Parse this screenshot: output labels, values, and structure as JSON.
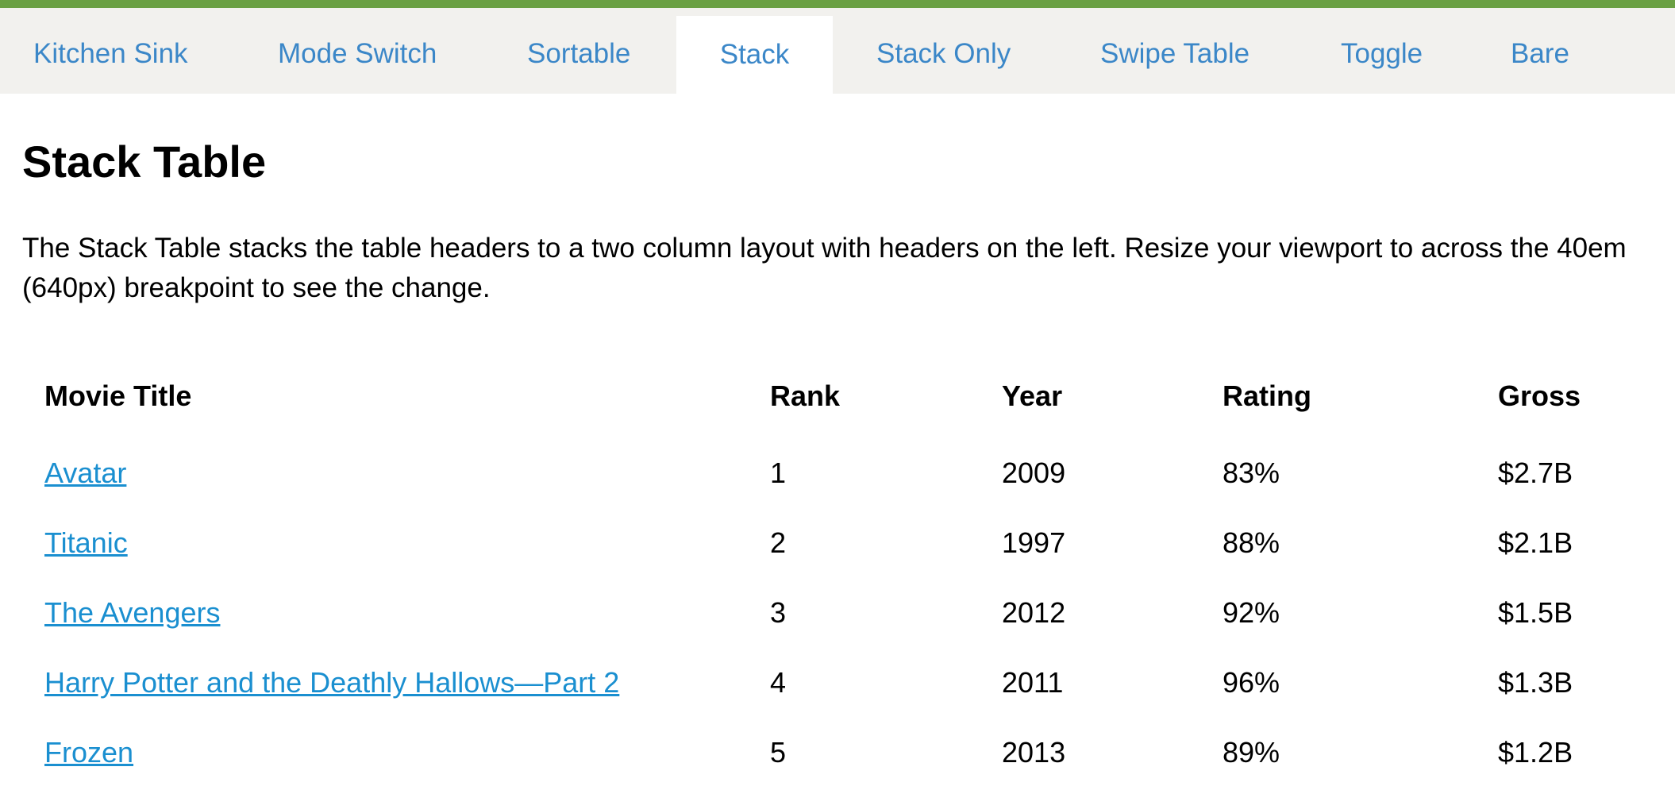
{
  "tabs": [
    {
      "label": "Kitchen Sink",
      "active": false
    },
    {
      "label": "Mode Switch",
      "active": false
    },
    {
      "label": "Sortable",
      "active": false
    },
    {
      "label": "Stack",
      "active": true
    },
    {
      "label": "Stack Only",
      "active": false
    },
    {
      "label": "Swipe Table",
      "active": false
    },
    {
      "label": "Toggle",
      "active": false
    },
    {
      "label": "Bare",
      "active": false
    }
  ],
  "page": {
    "title": "Stack Table",
    "description": "The Stack Table stacks the table headers to a two column layout with headers on the left. Resize your viewport to across the 40em (640px) breakpoint to see the change."
  },
  "table": {
    "headers": {
      "title": "Movie Title",
      "rank": "Rank",
      "year": "Year",
      "rating": "Rating",
      "gross": "Gross"
    },
    "rows": [
      {
        "title": "Avatar",
        "rank": "1",
        "year": "2009",
        "rating": "83%",
        "gross": "$2.7B"
      },
      {
        "title": "Titanic",
        "rank": "2",
        "year": "1997",
        "rating": "88%",
        "gross": "$2.1B"
      },
      {
        "title": "The Avengers",
        "rank": "3",
        "year": "2012",
        "rating": "92%",
        "gross": "$1.5B"
      },
      {
        "title": "Harry Potter and the Deathly Hallows—Part 2",
        "rank": "4",
        "year": "2011",
        "rating": "96%",
        "gross": "$1.3B"
      },
      {
        "title": "Frozen",
        "rank": "5",
        "year": "2013",
        "rating": "89%",
        "gross": "$1.2B"
      }
    ]
  },
  "colors": {
    "accent_bar": "#6aa043",
    "tab_text": "#3b87c8",
    "tab_bar_bg": "#f2f1ee",
    "link": "#1a8fd0"
  }
}
